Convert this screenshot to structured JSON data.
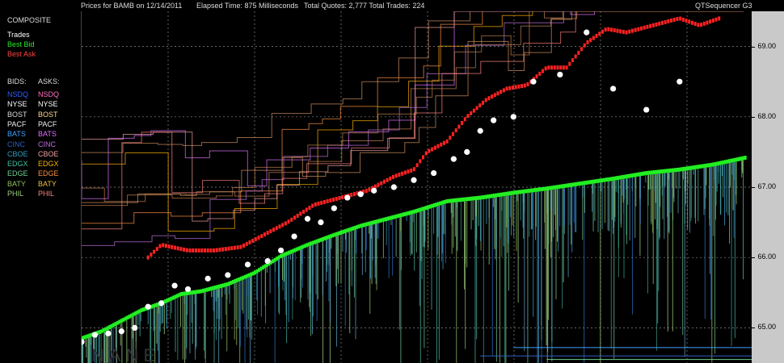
{
  "header": {
    "price_for": "Prices for  BAMB on  12/14/2011",
    "elapsed": "Elapsed Time: 875 Milliseconds",
    "quotes": "Total Quotes: 2,777  Total Trades: 224",
    "app": "QTSequencer G3"
  },
  "legend": {
    "title": "COMPOSITE",
    "trades": "Trades",
    "best_bid": "Best Bid",
    "best_ask": "Best Ask",
    "bids_header": "BIDS:",
    "asks_header": "ASKS:",
    "exchanges": [
      {
        "bid": "NSDQ",
        "ask": "NSDQ",
        "bid_color": "#3060ff",
        "ask_color": "#ff70c0"
      },
      {
        "bid": "NYSE",
        "ask": "NYSE",
        "bid_color": "#ffffff",
        "ask_color": "#ffffff"
      },
      {
        "bid": "BOST",
        "ask": "BOST",
        "bid_color": "#d8d8d8",
        "ask_color": "#ffd890"
      },
      {
        "bid": "PACF",
        "ask": "PACF",
        "bid_color": "#f0f0f0",
        "ask_color": "#f0f0f0"
      },
      {
        "bid": "BATS",
        "ask": "BATS",
        "bid_color": "#40a0ff",
        "ask_color": "#e070ff"
      },
      {
        "bid": "CINC",
        "ask": "CINC",
        "bid_color": "#3060c0",
        "ask_color": "#c070e0"
      },
      {
        "bid": "CBOE",
        "ask": "CBOE",
        "bid_color": "#30a0c0",
        "ask_color": "#f0a0a0"
      },
      {
        "bid": "EDGX",
        "ask": "EDGX",
        "bid_color": "#40c0a0",
        "ask_color": "#ffb000"
      },
      {
        "bid": "EDGE",
        "ask": "EDGE",
        "bid_color": "#70d090",
        "ask_color": "#ff9040"
      },
      {
        "bid": "BATY",
        "ask": "BATY",
        "bid_color": "#90c060",
        "ask_color": "#f0c040"
      },
      {
        "bid": "PHIL",
        "ask": "PHIL",
        "bid_color": "#a0d080",
        "ask_color": "#ff8080"
      }
    ],
    "colors": {
      "trades": "#ffffff",
      "best_bid": "#22ee22",
      "best_ask": "#ff2222"
    }
  },
  "watermark": "NANE",
  "chart_data": {
    "type": "scatter",
    "title": "Prices for  BAMB on  12/14/2011",
    "ylim": [
      64.5,
      69.5
    ],
    "y_ticks": [
      "69.00",
      "68.00",
      "67.00",
      "66.00",
      "65.00"
    ],
    "y_tick_values": [
      69.0,
      68.0,
      67.0,
      66.0,
      65.0
    ],
    "grid": true,
    "x_range": [
      0,
      100
    ],
    "series": [
      {
        "name": "Best Bid",
        "color": "#22ee22",
        "x": [
          0,
          3,
          6,
          9,
          12,
          15,
          18,
          22,
          26,
          30,
          34,
          38,
          42,
          46,
          50,
          55,
          60,
          65,
          70,
          75,
          80,
          85,
          90,
          95,
          100
        ],
        "y": [
          64.85,
          64.95,
          65.1,
          65.25,
          65.35,
          65.48,
          65.52,
          65.62,
          65.78,
          66.02,
          66.18,
          66.32,
          66.45,
          66.55,
          66.65,
          66.8,
          66.85,
          66.92,
          66.98,
          67.05,
          67.12,
          67.2,
          67.25,
          67.32,
          67.42
        ]
      },
      {
        "name": "Best Ask",
        "color": "#ff2222",
        "x": [
          10,
          12,
          16,
          20,
          24,
          28,
          31,
          35,
          39,
          43,
          47,
          50,
          52,
          55,
          58,
          61,
          64,
          67,
          70,
          73,
          76,
          79,
          82,
          86,
          90,
          93,
          96
        ],
        "y": [
          66.0,
          66.18,
          66.1,
          66.1,
          66.15,
          66.35,
          66.5,
          66.75,
          66.85,
          66.95,
          67.15,
          67.25,
          67.5,
          67.65,
          68.0,
          68.25,
          68.4,
          68.45,
          68.7,
          68.7,
          69.05,
          69.25,
          69.2,
          69.3,
          69.4,
          69.3,
          69.4
        ]
      },
      {
        "name": "Trades",
        "color": "#ffffff",
        "x": [
          0,
          2,
          4,
          6,
          8,
          10,
          12,
          14,
          16,
          19,
          22,
          25,
          28,
          30,
          32,
          34,
          36,
          38,
          40,
          42,
          44,
          47,
          50,
          53,
          56,
          58,
          60,
          62,
          65,
          68,
          72,
          76,
          80,
          85,
          90
        ],
        "y": [
          64.8,
          64.9,
          64.92,
          64.95,
          65.0,
          65.3,
          65.35,
          65.6,
          65.55,
          65.7,
          65.75,
          65.9,
          65.95,
          66.1,
          66.3,
          66.55,
          66.5,
          66.7,
          66.85,
          66.9,
          66.95,
          67.0,
          67.1,
          67.2,
          67.4,
          67.5,
          67.8,
          67.95,
          68.0,
          68.5,
          68.6,
          69.2,
          68.4,
          68.1,
          68.5
        ]
      }
    ]
  }
}
